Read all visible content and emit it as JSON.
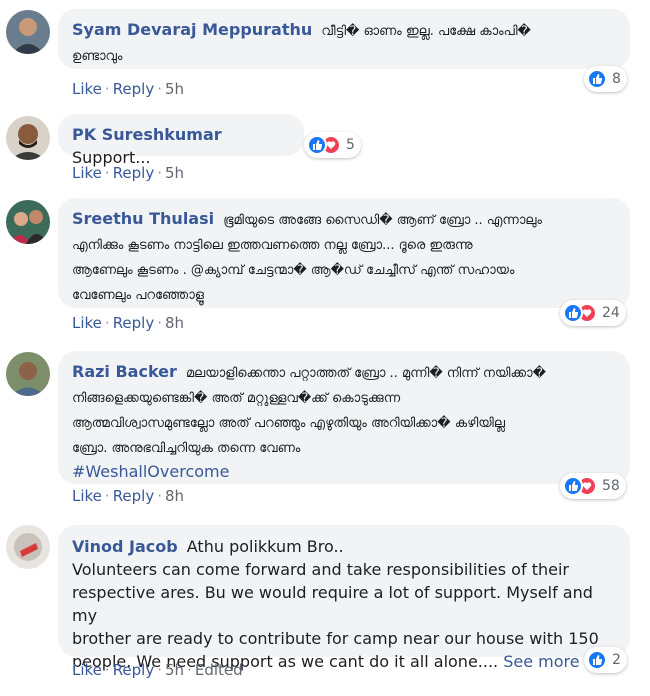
{
  "actions": {
    "like": "Like",
    "reply": "Reply",
    "edited": "Edited"
  },
  "comments": [
    {
      "author": "Syam Devaraj Meppurathu",
      "lines": [
        "വീട്ടി� ഓണം ഇല്ല. പക്ഷേ കാംപി�",
        "ഉണ്ടാവും"
      ],
      "time": "5h",
      "reactions": "8"
    },
    {
      "author": "PK Sureshkumar",
      "lines": [
        "Support..."
      ],
      "time": "5h",
      "reactions": "5"
    },
    {
      "author": "Sreethu Thulasi",
      "lines": [
        "ഭൂമിയുടെ അങ്ങേ സൈഡി� ആണ് ബ്രോ .. എന്നാലും",
        "എനിക്കും കൂടണം നാട്ടിലെ ഇത്തവണത്തെ നല്ല ബ്രോ... ദൂരെ ഇരുന്നു",
        "ആണേലും കൂടണം . @ക്യാമ്പ് ചേട്ടന്മാ� ആ�ഡ് ചേച്ചീസ് എന്ത് സഹായം",
        "വേണേലും പറഞ്ഞോളൂ"
      ],
      "time": "8h",
      "reactions": "24"
    },
    {
      "author": "Razi Backer",
      "lines": [
        "മലയാളിക്കെന്താ പറ്റാത്തത് ബ്രോ .. മുന്നി� നിന്ന് നയിക്കാ�",
        "നിങ്ങളെക്കയുണ്ടെങ്കി� അത് മറ്റുള്ളവ�ക്ക് കൊടുക്കുന്ന",
        "ആത്മവിശ്വാസമുണ്ടല്ലോ അത് പറഞ്ഞും എഴുതിയും അറിയിക്കാ� കഴിയില്ല",
        "ബ്രോ. അനുഭവിച്ചറിയുക തന്നെ വേണം"
      ],
      "hashtag": "#WeshallOvercome",
      "time": "8h",
      "reactions": "58"
    },
    {
      "author": "Vinod Jacob",
      "lines": [
        "Athu polikkum Bro..",
        "Volunteers can come forward and take responsibilities of their",
        "respective ares. Bu we would require a lot of support. Myself and my",
        "brother are ready to contribute for camp near our house with 150",
        "people. We need support as we cant do it all alone...."
      ],
      "see_more": "See more",
      "time": "5h",
      "reactions": "2"
    }
  ]
}
